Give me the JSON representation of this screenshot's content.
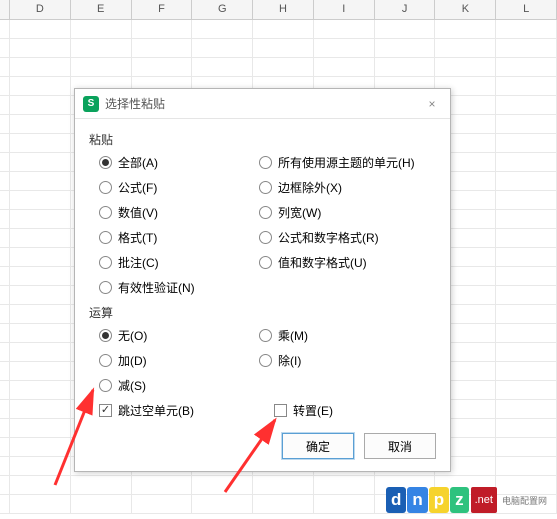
{
  "columns": [
    "D",
    "E",
    "F",
    "G",
    "H",
    "I",
    "J",
    "K",
    "L"
  ],
  "dialog": {
    "title": "选择性粘贴",
    "close_icon": "×",
    "group_paste": "粘贴",
    "paste_options_left": [
      {
        "label": "全部(A)",
        "selected": true
      },
      {
        "label": "公式(F)",
        "selected": false
      },
      {
        "label": "数值(V)",
        "selected": false
      },
      {
        "label": "格式(T)",
        "selected": false
      },
      {
        "label": "批注(C)",
        "selected": false
      },
      {
        "label": "有效性验证(N)",
        "selected": false
      }
    ],
    "paste_options_right": [
      {
        "label": "所有使用源主题的单元(H)",
        "selected": false
      },
      {
        "label": "边框除外(X)",
        "selected": false
      },
      {
        "label": "列宽(W)",
        "selected": false
      },
      {
        "label": "公式和数字格式(R)",
        "selected": false
      },
      {
        "label": "值和数字格式(U)",
        "selected": false
      }
    ],
    "group_operation": "运算",
    "op_options_left": [
      {
        "label": "无(O)",
        "selected": true
      },
      {
        "label": "加(D)",
        "selected": false
      },
      {
        "label": "减(S)",
        "selected": false
      }
    ],
    "op_options_right": [
      {
        "label": "乘(M)",
        "selected": false
      },
      {
        "label": "除(I)",
        "selected": false
      }
    ],
    "skip_blanks": {
      "label": "跳过空单元(B)",
      "checked": true
    },
    "transpose": {
      "label": "转置(E)",
      "checked": false
    },
    "ok": "确定",
    "cancel": "取消"
  },
  "watermark": {
    "brand": "dnpz",
    "suffix": ".net",
    "tagline": "电脑配置网"
  }
}
